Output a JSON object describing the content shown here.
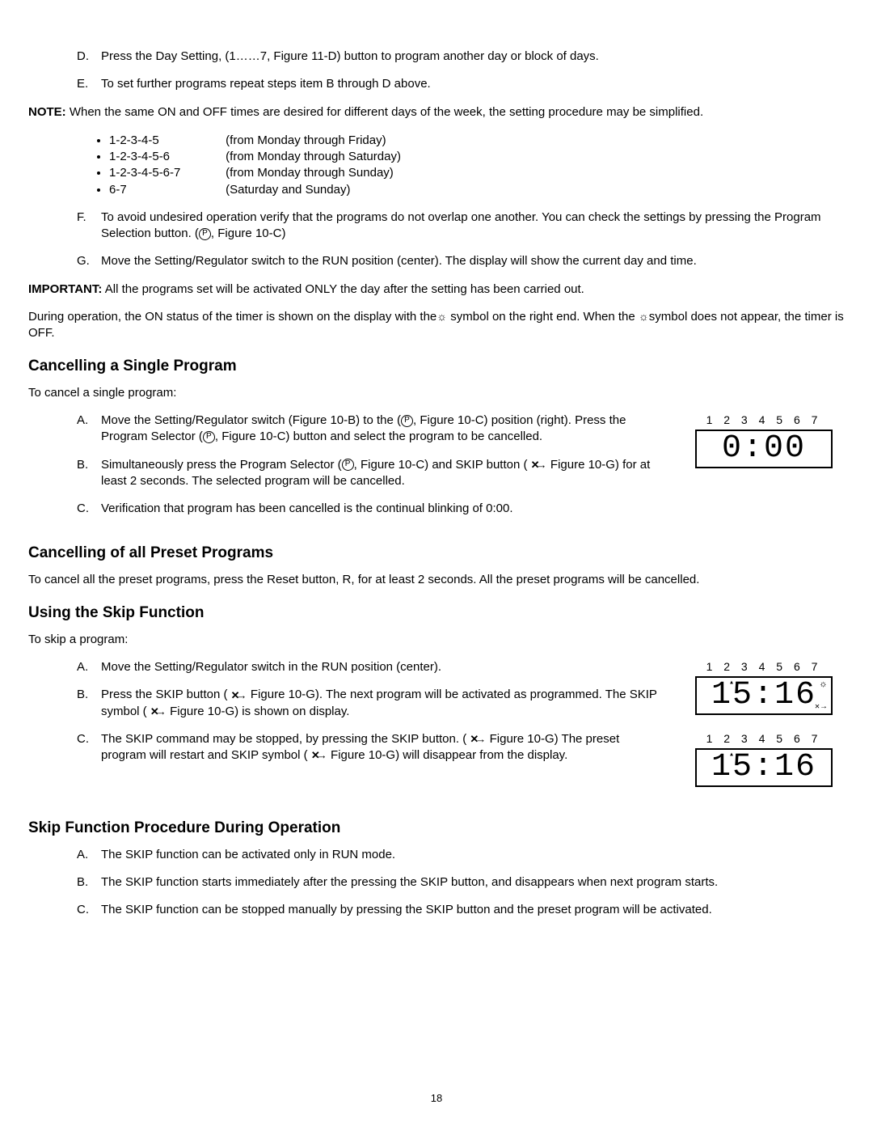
{
  "page_number": "18",
  "intro_list": {
    "D": "Press the Day Setting, (1……7, Figure 11-D) button to program another day or block of days.",
    "E": "To set further programs repeat steps item B through D above."
  },
  "note": {
    "label": "NOTE:",
    "text": "When the same ON and OFF times are desired for different days of the week, the setting procedure may be simplified.",
    "bullets": [
      {
        "code": "1-2-3-4-5",
        "desc": "(from Monday through Friday)"
      },
      {
        "code": "1-2-3-4-5-6",
        "desc": "(from Monday through Saturday)"
      },
      {
        "code": "1-2-3-4-5-6-7",
        "desc": "(from Monday through Sunday)"
      },
      {
        "code": "6-7",
        "desc": "(Saturday and Sunday)"
      }
    ]
  },
  "fg_list": {
    "F_pre": "To avoid undesired operation verify that the programs do not overlap one another.  You can check the settings by pressing the Program Selection button.  (",
    "F_post": ", Figure 10-C)",
    "G": "Move the Setting/Regulator switch to the RUN position (center).  The display will show the current day and time."
  },
  "important": {
    "label": "IMPORTANT:",
    "text": "All the programs set will be activated ONLY the day after the setting has been carried out."
  },
  "during_op_pre": "During operation, the ON status of the timer is shown on the display with the",
  "during_op_mid": " symbol on the right end.  When the ",
  "during_op_post": "symbol does not appear, the timer is OFF.",
  "sections": {
    "cancel_single": {
      "heading": "Cancelling a Single Program",
      "intro": "To cancel a single program:",
      "A_pre": "Move the Setting/Regulator switch (Figure 10-B) to the (",
      "A_mid": ", Figure 10-C) position (right).  Press the Program Selector (",
      "A_post": ", Figure 10-C) button and select the program to be cancelled.",
      "B_pre": "Simultaneously press the Program Selector (",
      "B_mid": ", Figure 10-C) and SKIP button ( ",
      "B_post": " Figure 10-G) for at least 2 seconds.  The selected program will be cancelled.",
      "C": "Verification that program has been cancelled is the continual blinking of 0:00."
    },
    "cancel_all": {
      "heading": "Cancelling of all Preset Programs",
      "text": "To cancel all the preset programs, press the Reset button, R, for at least 2 seconds.  All the preset programs will be cancelled."
    },
    "skip": {
      "heading": "Using the Skip Function",
      "intro": "To skip a program:",
      "A": "Move the Setting/Regulator switch in the RUN position (center).",
      "B_pre": "Press the SKIP button ( ",
      "B_mid": " Figure 10-G). The next program will be activated as programmed.  The SKIP symbol ( ",
      "B_post": " Figure 10-G) is shown on display.",
      "C_pre": "The SKIP command may be stopped, by pressing the SKIP button.  ( ",
      "C_mid": " Figure 10-G)  The preset program will restart and SKIP symbol ( ",
      "C_post": " Figure 10-G) will disappear from the display."
    },
    "skip_proc": {
      "heading": "Skip Function Procedure During Operation",
      "A": "The SKIP function can be activated only in RUN mode.",
      "B": "The SKIP function starts immediately after the pressing the SKIP button, and disappears when next program starts.",
      "C": "The SKIP function can be stopped manually by pressing the SKIP button and the preset program will be activated."
    }
  },
  "lcd": {
    "days": "1 2 3 4 5 6 7",
    "time_zero": "0:00",
    "time_clock": "15:16"
  },
  "glyphs": {
    "sun": "☼",
    "skip": "✕→",
    "p": "P",
    "arrow_up": "▴"
  }
}
